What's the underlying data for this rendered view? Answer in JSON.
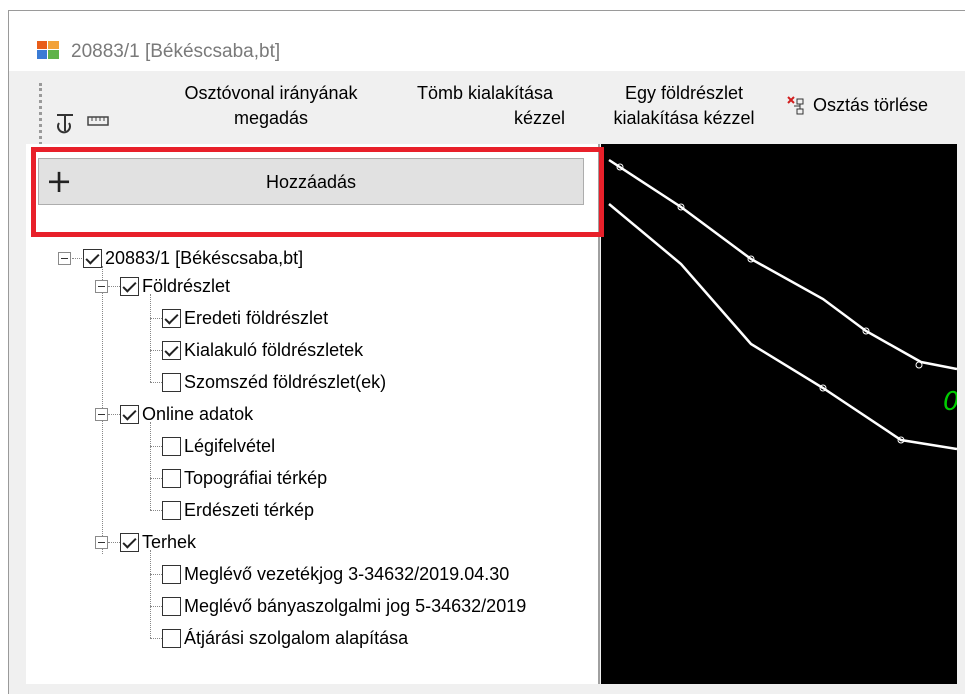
{
  "window": {
    "title": "20883/1 [Békéscsaba,bt]"
  },
  "toolbar": {
    "osztovonal_line1": "Osztóvonal irányának",
    "osztovonal_line2": "megadás",
    "tomb_line1": "Tömb kialakítása",
    "tomb_line2": "kézzel",
    "egy_line1": "Egy földrészlet",
    "egy_line2": "kialakítása kézzel",
    "osztas_torles": "Osztás törlése"
  },
  "add_button": {
    "label": "Hozzáadás"
  },
  "tree": {
    "root": {
      "label": "20883/1 [Békéscsaba,bt]",
      "checked": true
    },
    "foldreszlet": {
      "label": "Földrészlet",
      "checked": true
    },
    "eredeti": {
      "label": "Eredeti földrészlet",
      "checked": true
    },
    "kialakulo": {
      "label": "Kialakuló földrészletek",
      "checked": true
    },
    "szomszed": {
      "label": "Szomszéd földrészlet(ek)",
      "checked": false
    },
    "online": {
      "label": "Online adatok",
      "checked": true
    },
    "legifelvetel": {
      "label": "Légifelvétel",
      "checked": false
    },
    "topografiai": {
      "label": "Topográfiai térkép",
      "checked": false
    },
    "erdeszeti": {
      "label": "Erdészeti térkép",
      "checked": false
    },
    "terhek": {
      "label": "Terhek",
      "checked": true
    },
    "vezetekjog": {
      "label": "Meglévő vezetékjog 3-34632/2019.04.30",
      "checked": false
    },
    "banyaszolgalmi": {
      "label": "Meglévő bányaszolgalmi jog 5-34632/2019",
      "checked": false
    },
    "atjarasi": {
      "label": "Átjárási szolgalom alapítása",
      "checked": false
    }
  },
  "canvas": {
    "label_text": "0"
  },
  "colors": {
    "highlight": "#e8202a",
    "canvas_bg": "#000000",
    "canvas_label": "#00cc00"
  }
}
